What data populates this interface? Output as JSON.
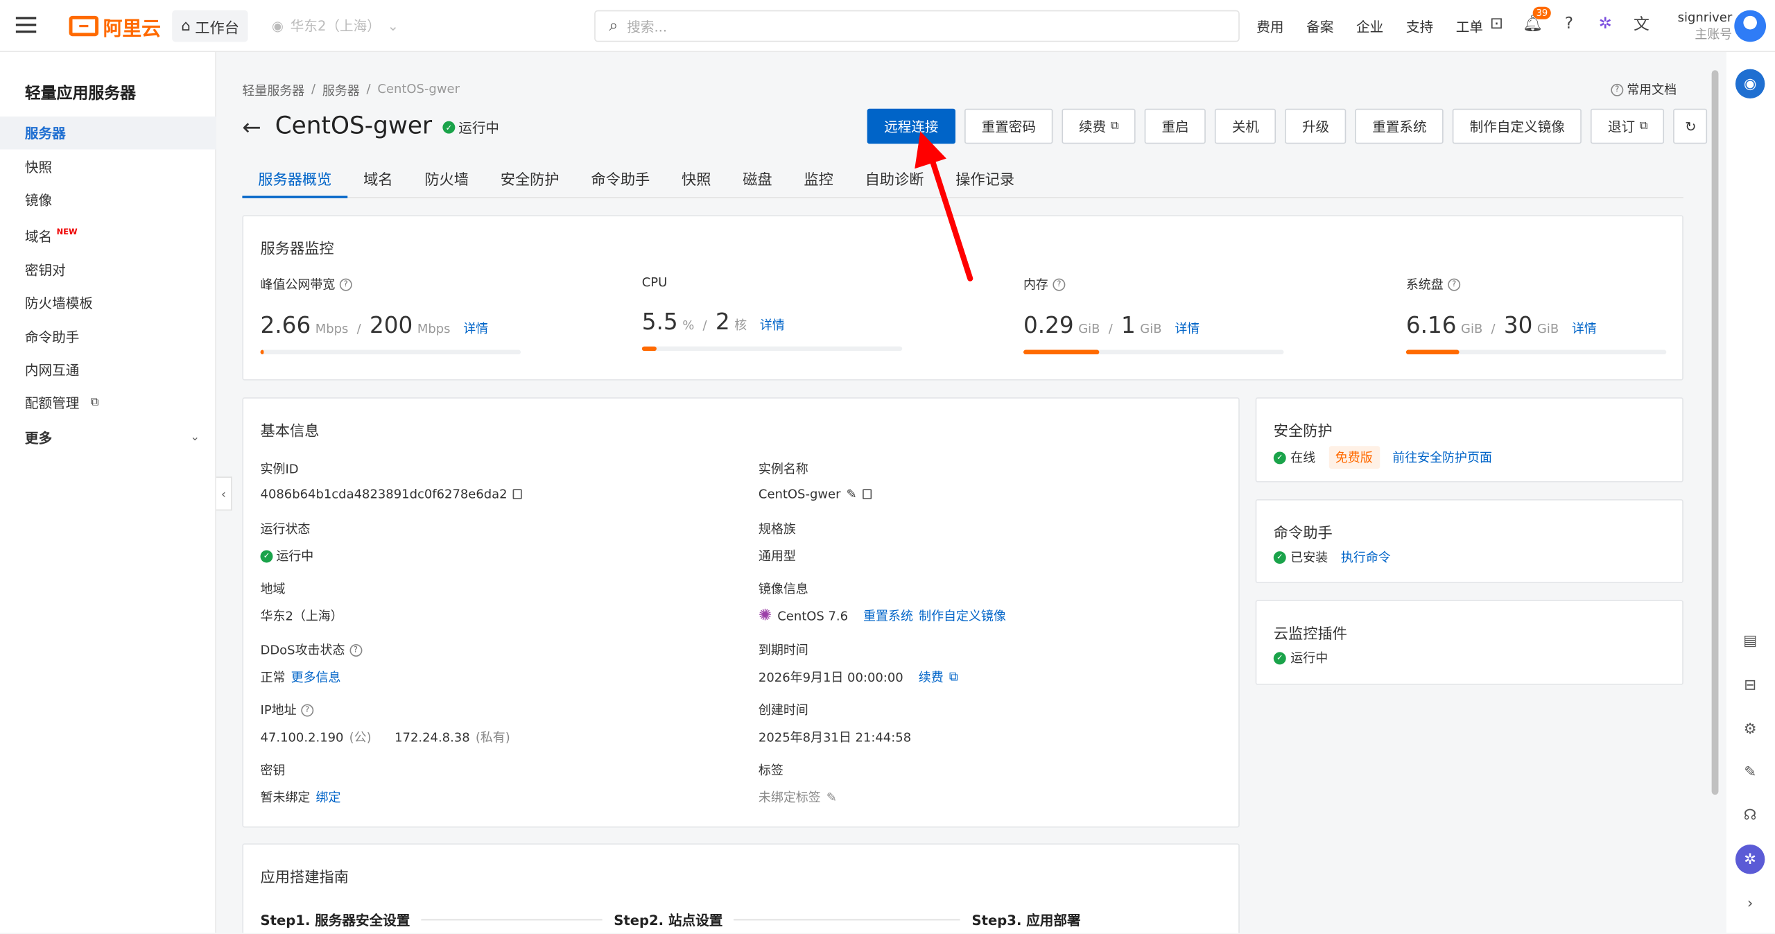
{
  "topbar": {
    "brand": "阿里云",
    "workbench": "工作台",
    "region": "华东2（上海）",
    "search_placeholder": "搜索...",
    "nav": [
      "费用",
      "备案",
      "企业",
      "支持",
      "工单"
    ],
    "notif_count": "39",
    "user": "signriver",
    "user_sub": "主账号"
  },
  "sidebar": {
    "title": "轻量应用服务器",
    "items": [
      {
        "label": "服务器"
      },
      {
        "label": "快照"
      },
      {
        "label": "镜像"
      },
      {
        "label": "域名",
        "badge": "NEW"
      },
      {
        "label": "密钥对"
      },
      {
        "label": "防火墙模板"
      },
      {
        "label": "命令助手"
      },
      {
        "label": "内网互通"
      },
      {
        "label": "配额管理"
      }
    ],
    "more": "更多"
  },
  "breadcrumb": [
    "轻量服务器",
    "服务器",
    "CentOS-gwer"
  ],
  "docs": "常用文档",
  "page": {
    "title": "CentOS-gwer",
    "status": "运行中"
  },
  "actions": [
    "远程连接",
    "重置密码",
    "续费",
    "重启",
    "关机",
    "升级",
    "重置系统",
    "制作自定义镜像",
    "退订"
  ],
  "tabs": [
    "服务器概览",
    "域名",
    "防火墙",
    "安全防护",
    "命令助手",
    "快照",
    "磁盘",
    "监控",
    "自助诊断",
    "操作记录"
  ],
  "monitor": {
    "title": "服务器监控",
    "detail": "详情",
    "items": [
      {
        "label": "峰值公网带宽",
        "used": "2.66",
        "used_unit": "Mbps",
        "total": "200",
        "total_unit": "Mbps",
        "ratio": 0.013
      },
      {
        "label": "CPU",
        "used": "5.5",
        "used_unit": "%",
        "total": "2",
        "total_unit": "核",
        "ratio": 0.055
      },
      {
        "label": "内存",
        "used": "0.29",
        "used_unit": "GiB",
        "total": "1",
        "total_unit": "GiB",
        "ratio": 0.29
      },
      {
        "label": "系统盘",
        "used": "6.16",
        "used_unit": "GiB",
        "total": "30",
        "total_unit": "GiB",
        "ratio": 0.205
      }
    ]
  },
  "basic": {
    "title": "基本信息",
    "instance_id_k": "实例ID",
    "instance_id": "4086b64b1cda4823891dc0f6278e6da2",
    "instance_name_k": "实例名称",
    "instance_name": "CentOS-gwer",
    "run_state_k": "运行状态",
    "run_state": "运行中",
    "spec_k": "规格族",
    "spec": "通用型",
    "region_k": "地域",
    "region": "华东2（上海）",
    "image_k": "镜像信息",
    "image": "CentOS 7.6",
    "image_reset": "重置系统",
    "image_custom": "制作自定义镜像",
    "ddos_k": "DDoS攻击状态",
    "ddos": "正常",
    "ddos_more": "更多信息",
    "expire_k": "到期时间",
    "expire": "2026年9月1日 00:00:00",
    "renew": "续费",
    "ip_k": "IP地址",
    "ip_pub": "47.100.2.190",
    "ip_pub_tag": "(公)",
    "ip_priv": "172.24.8.38",
    "ip_priv_tag": "(私有)",
    "created_k": "创建时间",
    "created": "2025年8月31日 21:44:58",
    "key_k": "密钥",
    "key": "暂未绑定",
    "key_bind": "绑定",
    "tag_k": "标签",
    "tag": "未绑定标签"
  },
  "security": {
    "title": "安全防护",
    "state": "在线",
    "plan": "免费版",
    "link": "前往安全防护页面"
  },
  "cmdhelper": {
    "title": "命令助手",
    "state": "已安装",
    "link": "执行命令"
  },
  "cms": {
    "title": "云监控插件",
    "state": "运行中"
  },
  "guide": {
    "title": "应用搭建指南",
    "steps": [
      "Step1. 服务器安全设置",
      "Step2. 站点设置",
      "Step3. 应用部署"
    ]
  },
  "colors": {
    "primary": "#0064c8",
    "accent": "#ff6a00",
    "ok": "#1aa34a",
    "annotation": "#ff0000"
  }
}
